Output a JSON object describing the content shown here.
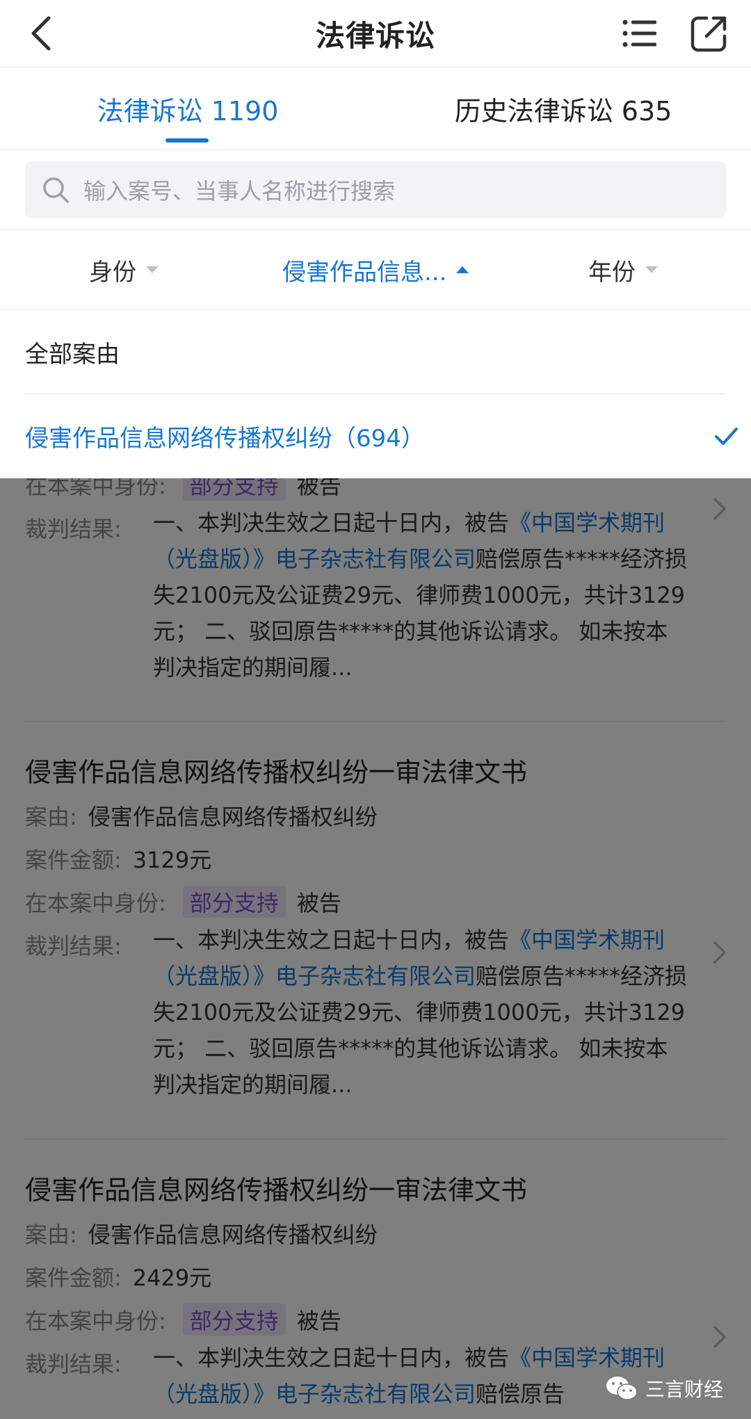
{
  "nav": {
    "title": "法律诉讼",
    "icons": {
      "back": "chevron-left-icon",
      "menu": "list-menu-icon",
      "share": "share-external-icon"
    }
  },
  "tabs": [
    {
      "label": "法律诉讼 1190",
      "active": true
    },
    {
      "label": "历史法律诉讼 635",
      "active": false
    }
  ],
  "search": {
    "placeholder": "输入案号、当事人名称进行搜索"
  },
  "filters": [
    {
      "label": "身份",
      "state": "collapsed"
    },
    {
      "label": "侵害作品信息...",
      "state": "expanded"
    },
    {
      "label": "年份",
      "state": "collapsed"
    }
  ],
  "dropdown": {
    "items": [
      {
        "label": "全部案由",
        "selected": false
      },
      {
        "label": "侵害作品信息网络传播权纠纷（694）",
        "selected": true
      }
    ]
  },
  "cases": [
    {
      "title": "",
      "identity_label": "在本案中身份:",
      "badge": "部分支持",
      "identity": "被告",
      "result_label": "裁判结果:",
      "result_pre": "一、本判决生效之日起十日内，被告",
      "result_link": "《中国学术期刊（光盘版）》电子杂志社有限公司",
      "result_post": "赔偿原告*****经济损失2100元及公证费29元、律师费1000元，共计3129元； 二、驳回原告*****的其他诉讼请求。 如未按本判决指定的期间履..."
    },
    {
      "title": "侵害作品信息网络传播权纠纷一审法律文书",
      "cause_label": "案由:",
      "cause": "侵害作品信息网络传播权纠纷",
      "amount_label": "案件金额:",
      "amount": "3129元",
      "identity_label": "在本案中身份:",
      "badge": "部分支持",
      "identity": "被告",
      "result_label": "裁判结果:",
      "result_pre": "一、本判决生效之日起十日内，被告",
      "result_link": "《中国学术期刊（光盘版）》电子杂志社有限公司",
      "result_post": "赔偿原告*****经济损失2100元及公证费29元、律师费1000元，共计3129元； 二、驳回原告*****的其他诉讼请求。 如未按本判决指定的期间履..."
    },
    {
      "title": "侵害作品信息网络传播权纠纷一审法律文书",
      "cause_label": "案由:",
      "cause": "侵害作品信息网络传播权纠纷",
      "amount_label": "案件金额:",
      "amount": "2429元",
      "identity_label": "在本案中身份:",
      "badge": "部分支持",
      "identity": "被告",
      "result_label": "裁判结果:",
      "result_pre": "一、本判决生效之日起十日内，被告",
      "result_link": "《中国学术期刊（光盘版）》电子杂志社有限公司",
      "result_post": "赔偿原告"
    }
  ],
  "watermark": {
    "text": "三言财经",
    "icon": "wechat-icon"
  },
  "colors": {
    "accent": "#1677d2",
    "badge_text": "#7c54c6",
    "badge_bg": "#efe7fb"
  }
}
